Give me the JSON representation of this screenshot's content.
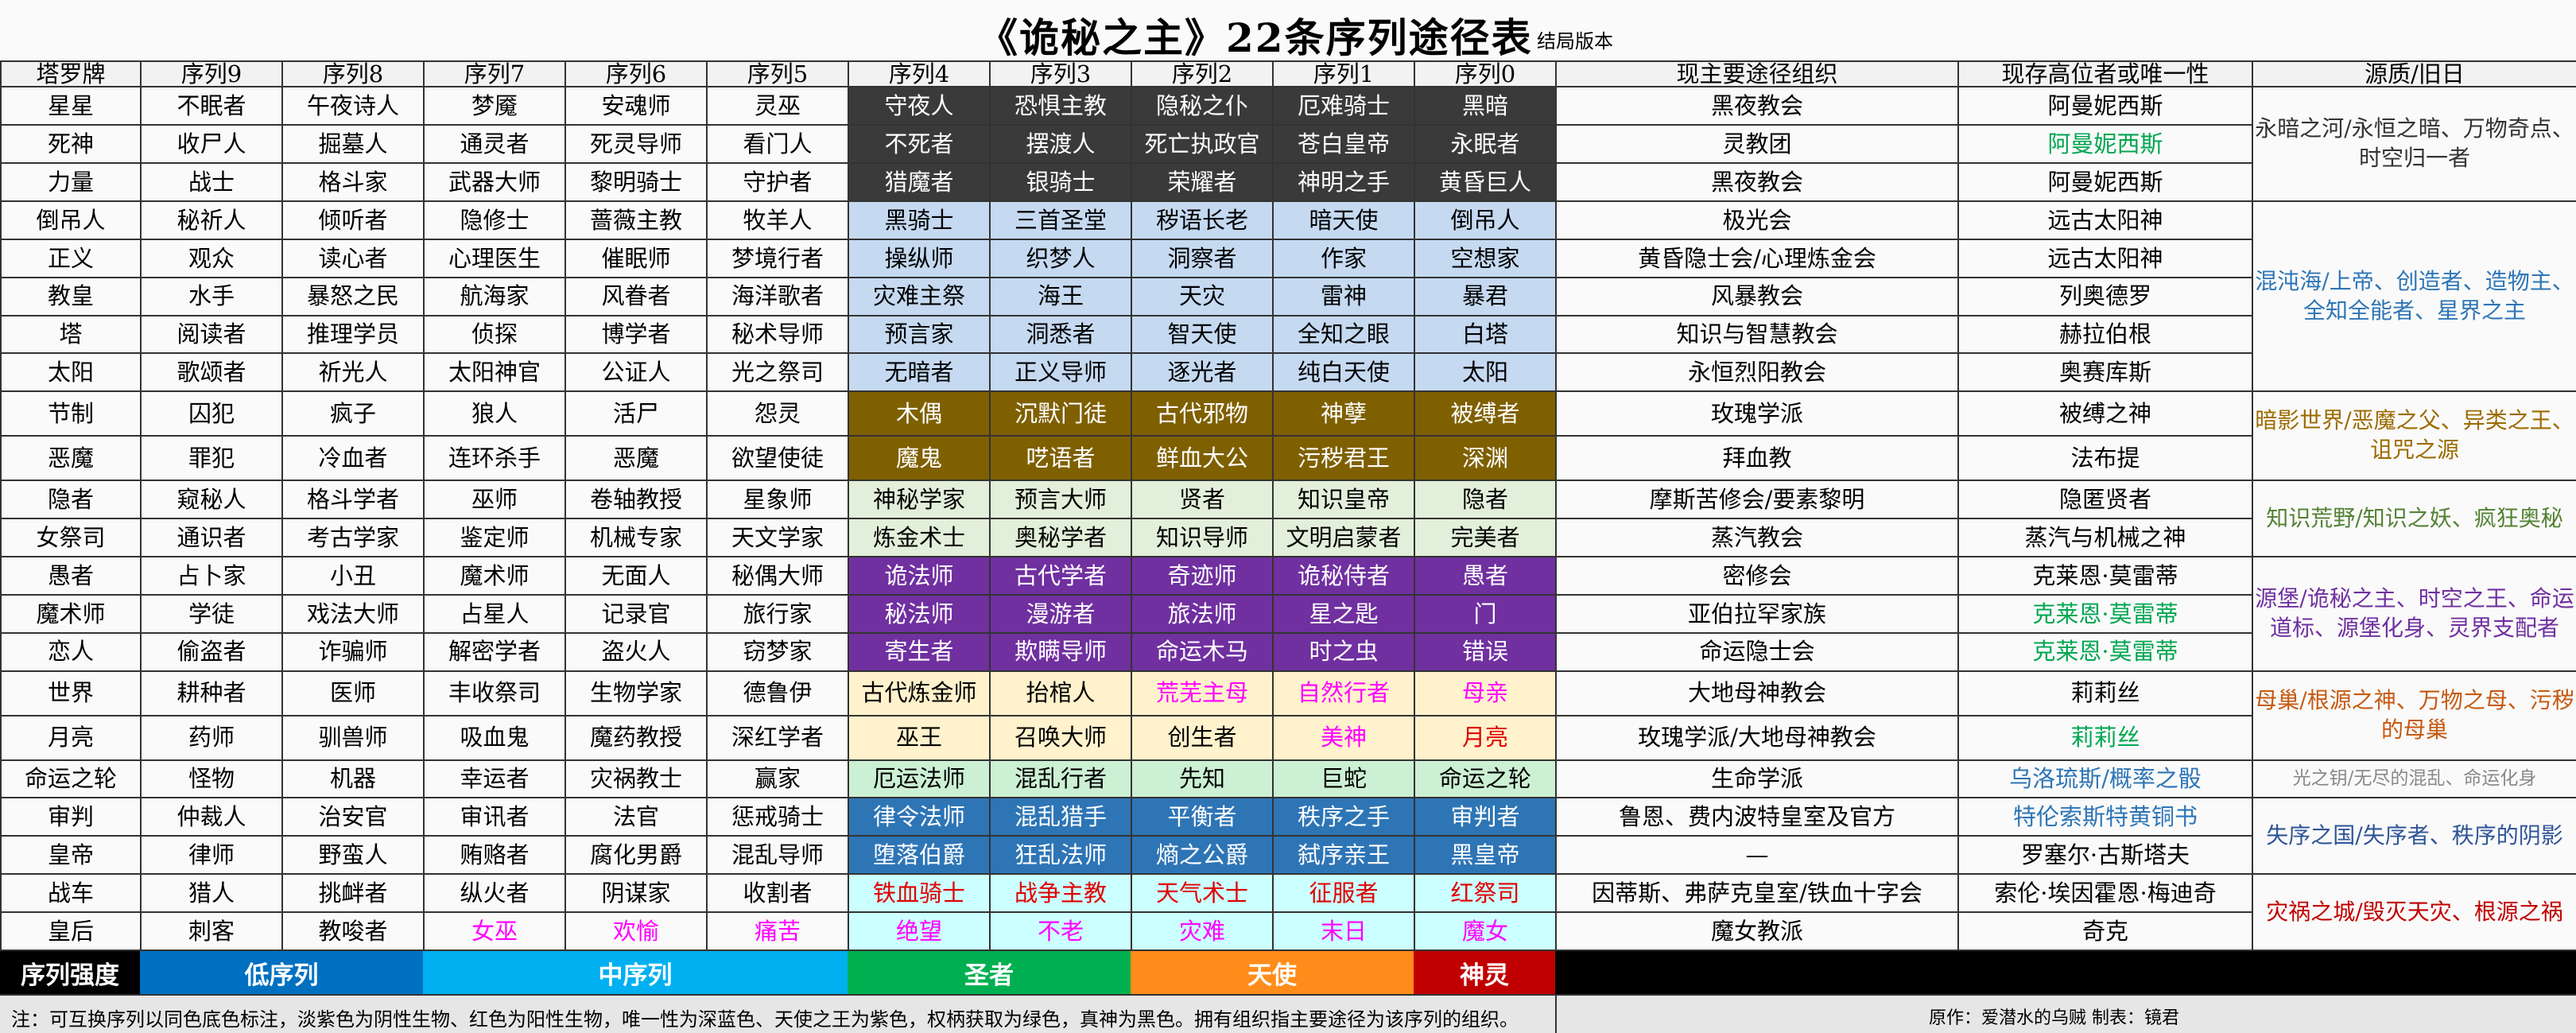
{
  "title": "《诡秘之主》22条序列途径表",
  "subtitle": "结局版本",
  "headers": [
    "塔罗牌",
    "序列9",
    "序列8",
    "序列7",
    "序列6",
    "序列5",
    "序列4",
    "序列3",
    "序列2",
    "序列1",
    "序列0",
    "现主要途径组织",
    "现存高位者或唯一性",
    "源质/旧日"
  ],
  "rows": [
    {
      "tarot": "星星",
      "seq": [
        "不眠者",
        "午夜诗人",
        "梦魇",
        "安魂师",
        "灵巫",
        "守夜人",
        "恐惧主教",
        "隐秘之仆",
        "厄难骑士",
        "黑暗"
      ],
      "org": "黑夜教会",
      "holder": "阿曼妮西斯"
    },
    {
      "tarot": "死神",
      "seq": [
        "收尸人",
        "掘墓人",
        "通灵者",
        "死灵导师",
        "看门人",
        "不死者",
        "摆渡人",
        "死亡执政官",
        "苍白皇帝",
        "永眠者"
      ],
      "org": "灵教团",
      "holder": "阿曼妮西斯"
    },
    {
      "tarot": "力量",
      "seq": [
        "战士",
        "格斗家",
        "武器大师",
        "黎明骑士",
        "守护者",
        "猎魔者",
        "银骑士",
        "荣耀者",
        "神明之手",
        "黄昏巨人"
      ],
      "org": "黑夜教会",
      "holder": "阿曼妮西斯"
    },
    {
      "tarot": "倒吊人",
      "seq": [
        "秘祈人",
        "倾听者",
        "隐修士",
        "蔷薇主教",
        "牧羊人",
        "黑骑士",
        "三首圣堂",
        "秽语长老",
        "暗天使",
        "倒吊人"
      ],
      "org": "极光会",
      "holder": "远古太阳神"
    },
    {
      "tarot": "正义",
      "seq": [
        "观众",
        "读心者",
        "心理医生",
        "催眠师",
        "梦境行者",
        "操纵师",
        "织梦人",
        "洞察者",
        "作家",
        "空想家"
      ],
      "org": "黄昏隐士会/心理炼金会",
      "holder": "远古太阳神"
    },
    {
      "tarot": "教皇",
      "seq": [
        "水手",
        "暴怒之民",
        "航海家",
        "风眷者",
        "海洋歌者",
        "灾难主祭",
        "海王",
        "天灾",
        "雷神",
        "暴君"
      ],
      "org": "风暴教会",
      "holder": "列奥德罗"
    },
    {
      "tarot": "塔",
      "seq": [
        "阅读者",
        "推理学员",
        "侦探",
        "博学者",
        "秘术导师",
        "预言家",
        "洞悉者",
        "智天使",
        "全知之眼",
        "白塔"
      ],
      "org": "知识与智慧教会",
      "holder": "赫拉伯根"
    },
    {
      "tarot": "太阳",
      "seq": [
        "歌颂者",
        "祈光人",
        "太阳神官",
        "公证人",
        "光之祭司",
        "无暗者",
        "正义导师",
        "逐光者",
        "纯白天使",
        "太阳"
      ],
      "org": "永恒烈阳教会",
      "holder": "奥赛库斯"
    },
    {
      "tarot": "节制",
      "seq": [
        "囚犯",
        "疯子",
        "狼人",
        "活尸",
        "怨灵",
        "木偶",
        "沉默门徒",
        "古代邪物",
        "神孽",
        "被缚者"
      ],
      "org": "玫瑰学派",
      "holder": "被缚之神"
    },
    {
      "tarot": "恶魔",
      "seq": [
        "罪犯",
        "冷血者",
        "连环杀手",
        "恶魔",
        "欲望使徒",
        "魔鬼",
        "呓语者",
        "鲜血大公",
        "污秽君王",
        "深渊"
      ],
      "org": "拜血教",
      "holder": "法布提"
    },
    {
      "tarot": "隐者",
      "seq": [
        "窥秘人",
        "格斗学者",
        "巫师",
        "卷轴教授",
        "星象师",
        "神秘学家",
        "预言大师",
        "贤者",
        "知识皇帝",
        "隐者"
      ],
      "org": "摩斯苦修会/要素黎明",
      "holder": "隐匿贤者"
    },
    {
      "tarot": "女祭司",
      "seq": [
        "通识者",
        "考古学家",
        "鉴定师",
        "机械专家",
        "天文学家",
        "炼金术士",
        "奥秘学者",
        "知识导师",
        "文明启蒙者",
        "完美者"
      ],
      "org": "蒸汽教会",
      "holder": "蒸汽与机械之神"
    },
    {
      "tarot": "愚者",
      "seq": [
        "占卜家",
        "小丑",
        "魔术师",
        "无面人",
        "秘偶大师",
        "诡法师",
        "古代学者",
        "奇迹师",
        "诡秘侍者",
        "愚者"
      ],
      "org": "密修会",
      "holder": "克莱恩·莫雷蒂"
    },
    {
      "tarot": "魔术师",
      "seq": [
        "学徒",
        "戏法大师",
        "占星人",
        "记录官",
        "旅行家",
        "秘法师",
        "漫游者",
        "旅法师",
        "星之匙",
        "门"
      ],
      "org": "亚伯拉罕家族",
      "holder": "克莱恩·莫雷蒂"
    },
    {
      "tarot": "恋人",
      "seq": [
        "偷盗者",
        "诈骗师",
        "解密学者",
        "盗火人",
        "窃梦家",
        "寄生者",
        "欺瞒导师",
        "命运木马",
        "时之虫",
        "错误"
      ],
      "org": "命运隐士会",
      "holder": "克莱恩·莫雷蒂"
    },
    {
      "tarot": "世界",
      "seq": [
        "耕种者",
        "医师",
        "丰收祭司",
        "生物学家",
        "德鲁伊",
        "古代炼金师",
        "抬棺人",
        "荒芜主母",
        "自然行者",
        "母亲"
      ],
      "org": "大地母神教会",
      "holder": "莉莉丝"
    },
    {
      "tarot": "月亮",
      "seq": [
        "药师",
        "驯兽师",
        "吸血鬼",
        "魔药教授",
        "深红学者",
        "巫王",
        "召唤大师",
        "创生者",
        "美神",
        "月亮"
      ],
      "org": "玫瑰学派/大地母神教会",
      "holder": "莉莉丝"
    },
    {
      "tarot": "命运之轮",
      "seq": [
        "怪物",
        "机器",
        "幸运者",
        "灾祸教士",
        "赢家",
        "厄运法师",
        "混乱行者",
        "先知",
        "巨蛇",
        "命运之轮"
      ],
      "org": "生命学派",
      "holder": "乌洛琉斯/概率之骰"
    },
    {
      "tarot": "审判",
      "seq": [
        "仲裁人",
        "治安官",
        "审讯者",
        "法官",
        "惩戒骑士",
        "律令法师",
        "混乱猎手",
        "平衡者",
        "秩序之手",
        "审判者"
      ],
      "org": "鲁恩、费内波特皇室及官方",
      "holder": "特伦索斯特黄铜书"
    },
    {
      "tarot": "皇帝",
      "seq": [
        "律师",
        "野蛮人",
        "贿赂者",
        "腐化男爵",
        "混乱导师",
        "堕落伯爵",
        "狂乱法师",
        "熵之公爵",
        "弑序亲王",
        "黑皇帝"
      ],
      "org": "—",
      "holder": "罗塞尔·古斯塔夫"
    },
    {
      "tarot": "战车",
      "seq": [
        "猎人",
        "挑衅者",
        "纵火者",
        "阴谋家",
        "收割者",
        "铁血骑士",
        "战争主教",
        "天气术士",
        "征服者",
        "红祭司"
      ],
      "org": "因蒂斯、弗萨克皇室/铁血十字会",
      "holder": "索伦·埃因霍恩·梅迪奇"
    },
    {
      "tarot": "皇后",
      "seq": [
        "刺客",
        "教唆者",
        "女巫",
        "欢愉",
        "痛苦",
        "绝望",
        "不老",
        "灾难",
        "末日",
        "魔女"
      ],
      "org": "魔女教派",
      "holder": "奇克"
    }
  ],
  "sources": [
    {
      "text": "永暗之河/永恒之暗、万物奇点、时空归一者",
      "color": "#333333"
    },
    {
      "text": "混沌海/上帝、创造者、造物主、全知全能者、星界之主",
      "color": "#2e75b6"
    },
    {
      "text": "暗影世界/恶魔之父、异类之王、诅咒之源",
      "color": "#9c6b00"
    },
    {
      "text": "知识荒野/知识之妖、疯狂奥秘",
      "color": "#548235"
    },
    {
      "text": "源堡/诡秘之主、时空之王、命运道标、源堡化身、灵界支配者",
      "color": "#7030a0"
    },
    {
      "text": "母巢/根源之神、万物之母、污秽的母巢",
      "color": "#c55a11"
    },
    {
      "text": "光之钥/无尽的混乱、命运化身",
      "color": "#888888"
    },
    {
      "text": "失序之国/失序者、秩序的阴影",
      "color": "#2f5597"
    },
    {
      "text": "灾祸之城/毁灭天灾、根源之祸",
      "color": "#c00000"
    }
  ],
  "strength": {
    "label": "序列强度",
    "low": "低序列",
    "mid": "中序列",
    "saint": "圣者",
    "angel": "天使",
    "god": "神灵",
    "colors": {
      "low": "#0070c0",
      "mid": "#00b0f0",
      "saint": "#00b050",
      "angel": "#ff8c1a",
      "god": "#c00000"
    }
  },
  "footer": {
    "note": "注：可互换序列以同色底色标注，淡紫色为阴性生物、红色为阳性生物，唯一性为深蓝色、天使之王为紫色，权柄获取为绿色，真神为黑色。拥有组织指主要途径为该序列的组织。",
    "credits": "原作：爱潜水的乌贼    制表：镜君"
  },
  "palette": {
    "dark": "#3a3a3a",
    "lightblue": "#c5d9f1",
    "gold": "#7f6000",
    "palegreen": "#e2efda",
    "purple": "#7030a0",
    "cream": "#fff2cc",
    "mint": "#ccf0d4",
    "navy": "#2e75b6",
    "aqua": "#ccffff",
    "green": "#00a651",
    "pink": "#ff00ff",
    "red": "#e00000",
    "orange": "#ff8c00",
    "lightgreen": "#d9ead3"
  }
}
